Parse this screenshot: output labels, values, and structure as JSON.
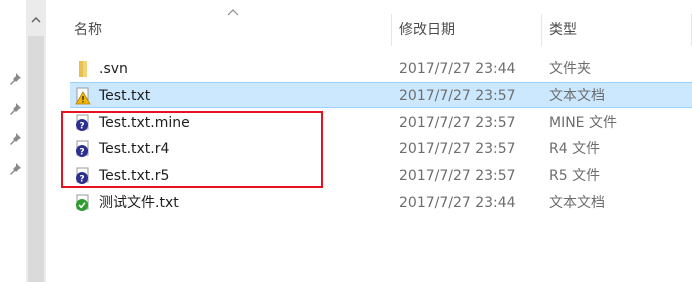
{
  "header": {
    "name_label": "名称",
    "date_label": "修改日期",
    "type_label": "类型"
  },
  "files": [
    {
      "name": ".svn",
      "date": "2017/7/27 23:44",
      "type": "文件夹",
      "icon": "folder-icon"
    },
    {
      "name": "Test.txt",
      "date": "2017/7/27 23:57",
      "type": "文本文档",
      "icon": "svn-conflict-file-icon",
      "selected": true
    },
    {
      "name": "Test.txt.mine",
      "date": "2017/7/27 23:57",
      "type": "MINE 文件",
      "icon": "svn-unversioned-file-icon"
    },
    {
      "name": "Test.txt.r4",
      "date": "2017/7/27 23:57",
      "type": "R4 文件",
      "icon": "svn-unversioned-file-icon"
    },
    {
      "name": "Test.txt.r5",
      "date": "2017/7/27 23:57",
      "type": "R5 文件",
      "icon": "svn-unversioned-file-icon"
    },
    {
      "name": "测试文件.txt",
      "date": "2017/7/27 23:44",
      "type": "文本文档",
      "icon": "svn-normal-file-icon"
    }
  ],
  "colors": {
    "selection": "#cce8ff",
    "highlight_box": "#e81123"
  }
}
